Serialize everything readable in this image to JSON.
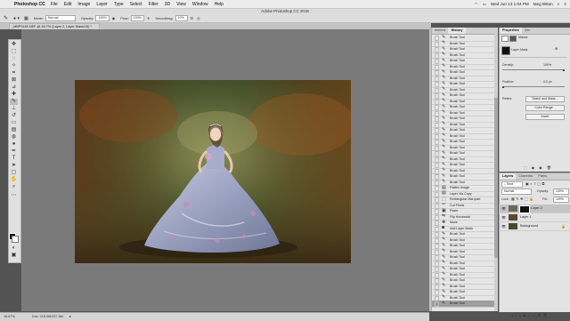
{
  "menubar": {
    "app_name": "Photoshop CC",
    "menus": [
      "File",
      "Edit",
      "Image",
      "Layer",
      "Type",
      "Select",
      "Filter",
      "3D",
      "View",
      "Window",
      "Help"
    ],
    "clock": "Wed Jun 13  1:04 PM",
    "user": "Meg Bitton"
  },
  "window_title": "Adobe Photoshop CC 2018",
  "options": {
    "mode_label": "Mode:",
    "mode_value": "Normal",
    "opacity_label": "Opacity:",
    "opacity_value": "100%",
    "flow_label": "Flow:",
    "flow_value": "100%",
    "smoothing_label": "Smoothing:",
    "smoothing_value": "10%"
  },
  "document": {
    "tab_title": "_MBP9169.NEF @ 16.7% (Layer 2, Layer Mask/16) *",
    "zoom": "16.67%",
    "doc_info": "Doc: 118.0M/297.8M"
  },
  "history_panel": {
    "tabs": [
      "Actions",
      "History"
    ],
    "active_tab": "History",
    "items": [
      {
        "label": "Brush Tool",
        "icon": "brush-icon"
      },
      {
        "label": "Brush Tool",
        "icon": "brush-icon"
      },
      {
        "label": "Brush Tool",
        "icon": "brush-icon"
      },
      {
        "label": "Brush Tool",
        "icon": "brush-icon"
      },
      {
        "label": "Brush Tool",
        "icon": "brush-icon"
      },
      {
        "label": "Brush Tool",
        "icon": "brush-icon"
      },
      {
        "label": "Brush Tool",
        "icon": "brush-icon"
      },
      {
        "label": "Brush Tool",
        "icon": "brush-icon"
      },
      {
        "label": "Brush Tool",
        "icon": "brush-icon"
      },
      {
        "label": "Brush Tool",
        "icon": "brush-icon"
      },
      {
        "label": "Brush Tool",
        "icon": "brush-icon"
      },
      {
        "label": "Brush Tool",
        "icon": "brush-icon"
      },
      {
        "label": "Brush Tool",
        "icon": "brush-icon"
      },
      {
        "label": "Brush Tool",
        "icon": "brush-icon"
      },
      {
        "label": "Brush Tool",
        "icon": "brush-icon"
      },
      {
        "label": "Brush Tool",
        "icon": "brush-icon"
      },
      {
        "label": "Brush Tool",
        "icon": "brush-icon"
      },
      {
        "label": "Brush Tool",
        "icon": "brush-icon"
      },
      {
        "label": "Brush Tool",
        "icon": "brush-icon"
      },
      {
        "label": "Brush Tool",
        "icon": "brush-icon"
      },
      {
        "label": "Brush Tool",
        "icon": "brush-icon"
      },
      {
        "label": "Brush Tool",
        "icon": "brush-icon"
      },
      {
        "label": "Brush Tool",
        "icon": "brush-icon"
      },
      {
        "label": "Brush Tool",
        "icon": "brush-icon"
      },
      {
        "label": "Brush Tool",
        "icon": "brush-icon"
      },
      {
        "label": "Brush Tool",
        "icon": "brush-icon"
      },
      {
        "label": "Flatten Image",
        "icon": "layers-icon"
      },
      {
        "label": "Layer Via Copy",
        "icon": "layers-icon"
      },
      {
        "label": "Rectangular Marquee",
        "icon": "marquee-icon"
      },
      {
        "label": "Cut Pixels",
        "icon": "scissors-icon"
      },
      {
        "label": "Paste",
        "icon": "paste-icon"
      },
      {
        "label": "Flip Horizontal",
        "icon": "flip-icon"
      },
      {
        "label": "Move",
        "icon": "move-icon"
      },
      {
        "label": "Add Layer Mask",
        "icon": "mask-icon"
      },
      {
        "label": "Brush Tool",
        "icon": "brush-icon"
      },
      {
        "label": "Brush Tool",
        "icon": "brush-icon"
      },
      {
        "label": "Brush Tool",
        "icon": "brush-icon"
      },
      {
        "label": "Brush Tool",
        "icon": "brush-icon"
      },
      {
        "label": "Brush Tool",
        "icon": "brush-icon"
      },
      {
        "label": "Brush Tool",
        "icon": "brush-icon"
      },
      {
        "label": "Brush Tool",
        "icon": "brush-icon"
      },
      {
        "label": "Brush Tool",
        "icon": "brush-icon"
      },
      {
        "label": "Brush Tool",
        "icon": "brush-icon"
      },
      {
        "label": "Brush Tool",
        "icon": "brush-icon"
      },
      {
        "label": "Brush Tool",
        "icon": "brush-icon"
      },
      {
        "label": "Brush Tool",
        "icon": "brush-icon"
      },
      {
        "label": "Brush Tool",
        "icon": "brush-icon"
      }
    ],
    "selected_index": 46
  },
  "properties_panel": {
    "tabs": [
      "Properties",
      "Info"
    ],
    "active_tab": "Properties",
    "masks_label": "Masks",
    "layer_mask_label": "Layer Mask",
    "density_label": "Density:",
    "density_value": "100%",
    "feather_label": "Feather:",
    "feather_value": "0.0 px",
    "refine_label": "Refine:",
    "select_and_mask": "Select and Mask...",
    "color_range": "Color Range...",
    "invert": "Invert"
  },
  "layers_panel": {
    "tabs": [
      "Layers",
      "Channels",
      "Paths"
    ],
    "active_tab": "Layers",
    "kind_label": "Kind",
    "blend_mode": "Normal",
    "opacity_label": "Opacity:",
    "opacity_value": "100%",
    "lock_label": "Lock:",
    "fill_label": "Fill:",
    "fill_value": "100%",
    "layers": [
      {
        "name": "Layer 2",
        "selected": true,
        "has_mask": true
      },
      {
        "name": "Layer 1",
        "selected": false,
        "has_mask": false
      },
      {
        "name": "Background",
        "selected": false,
        "has_mask": false
      }
    ]
  },
  "colors": {
    "foreground": "#111111",
    "background": "#ffffff",
    "accent_selected": "#9e9e9e"
  }
}
